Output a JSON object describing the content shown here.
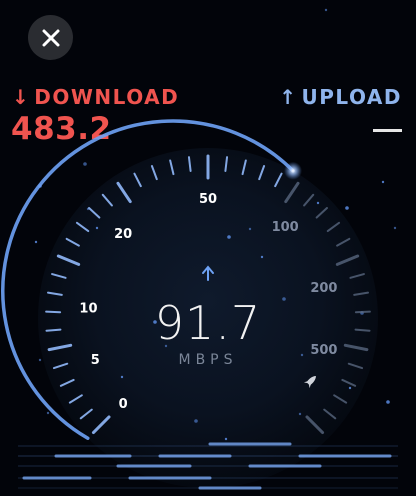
{
  "close_icon": "close-icon",
  "download": {
    "arrow": "↓",
    "label": "DOWNLOAD",
    "value": "483.2",
    "color": "#f0544f"
  },
  "upload": {
    "arrow": "↑",
    "label": "UPLOAD",
    "value": "—",
    "color": "#8fb4ec"
  },
  "gauge": {
    "current_value": "91.7",
    "unit": "MBPS",
    "direction_icon": "up-arrow-icon",
    "end_icon": "rocket-icon",
    "scale_labels_left": [
      "0",
      "5",
      "10",
      "20",
      "50"
    ],
    "scale_labels_right": [
      "100",
      "200",
      "500"
    ],
    "accent_color": "#6ea2f5"
  }
}
